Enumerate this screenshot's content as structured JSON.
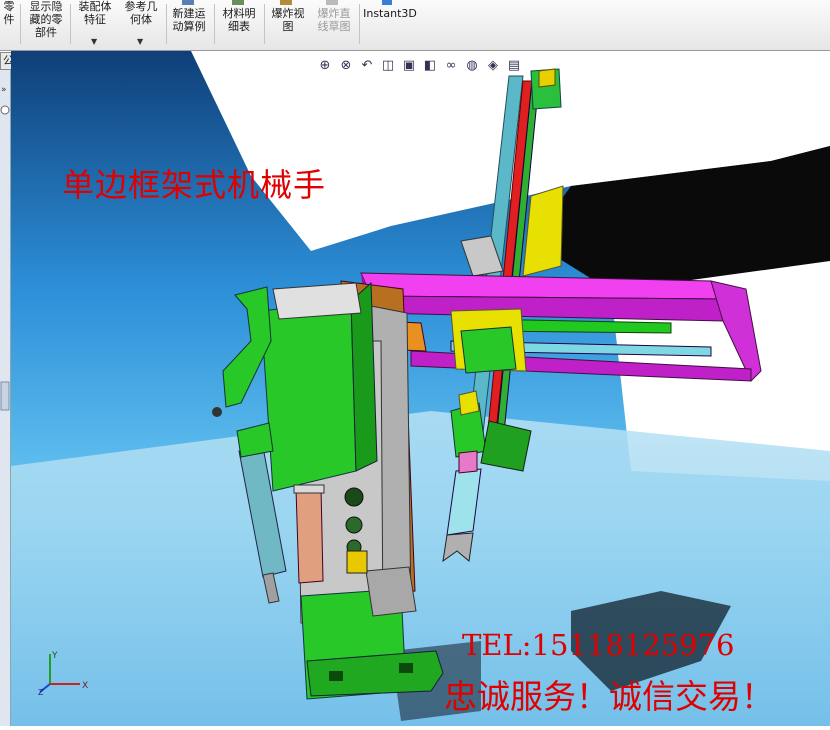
{
  "toolbar": {
    "buttons": [
      {
        "label": "零\n件",
        "icon": "part-icon"
      },
      {
        "label": "显示隐\n藏的零\n部件",
        "icon": "show-hidden-icon"
      },
      {
        "label": "装配体\n特征",
        "icon": "assembly-feature-icon"
      },
      {
        "label": "参考几\n何体",
        "icon": "reference-geometry-icon"
      },
      {
        "label": "新建运\n动算例",
        "icon": "motion-study-icon"
      },
      {
        "label": "材料明\n细表",
        "icon": "bom-icon"
      },
      {
        "label": "爆炸视\n图",
        "icon": "exploded-view-icon"
      },
      {
        "label": "爆炸直\n线草图",
        "icon": "explode-line-sketch-icon"
      },
      {
        "label": "Instant3D",
        "icon": "instant3d-icon"
      }
    ]
  },
  "feature_tree": {
    "tab_label": "公室产品"
  },
  "heads_up": [
    "zoom-to-fit-icon",
    "zoom-area-icon",
    "previous-view-icon",
    "section-view-icon",
    "view-orientation-icon",
    "display-style-icon",
    "hide-show-icon",
    "edit-appearance-icon",
    "apply-scene-icon",
    "view-settings-icon"
  ],
  "overlay": {
    "title": "单边框架式机械手",
    "tel": "TEL:15118125976",
    "slogan": "忠诚服务！诚信交易！"
  },
  "triad": {
    "x_label": "X",
    "y_label": "Y",
    "z_label": "Z"
  },
  "colors": {
    "title_red": "#e00000",
    "magenta_frame": "#d020d0",
    "green_body": "#28c828",
    "cyan_pole": "#5ab8c8",
    "yellow_slider": "#e8e000"
  }
}
